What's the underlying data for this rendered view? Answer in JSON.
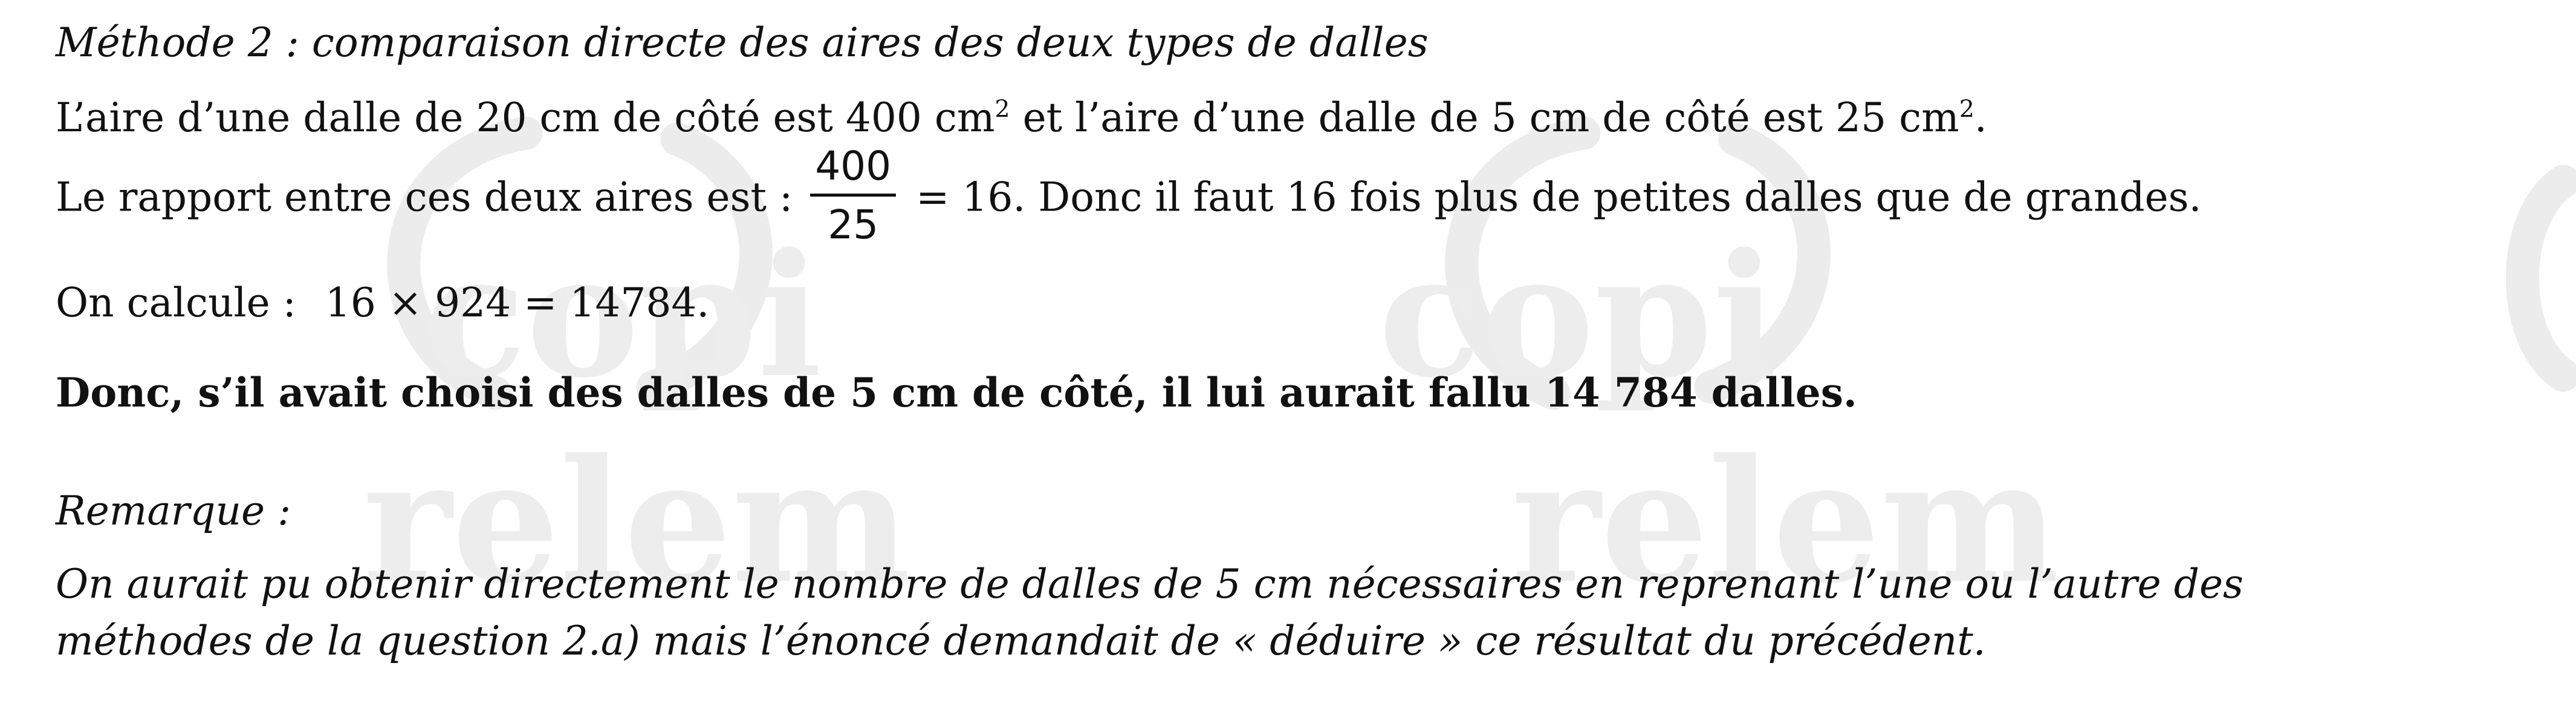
{
  "method_heading": "Méthode 2 : comparaison directe des aires des deux types de dalles",
  "area_line": {
    "part1": "L’aire d’une dalle de 20 cm de côté est 400 cm",
    "sup1": "2",
    "part2": " et l’aire d’une dalle de 5 cm de côté est 25 cm",
    "sup2": "2",
    "part3": "."
  },
  "ratio_line": {
    "intro": "Le rapport entre ces deux aires est :",
    "numerator": "400",
    "denominator": "25",
    "rest": "= 16. Donc il faut 16 fois plus de petites dalles que de grandes."
  },
  "calc_line": {
    "label": "On calcule :",
    "expression": "16 × 924 = 14784."
  },
  "conclusion": "Donc, s’il avait choisi des dalles de 5 cm de côté, il lui aurait fallu 14 784 dalles.",
  "remark_heading": "Remarque :",
  "remark_lines": [
    "On aurait pu obtenir directement le nombre de dalles de 5 cm nécessaires en reprenant l’une ou l’autre des",
    "méthodes de la question 2.a) mais l’énoncé demandait de « déduire » ce résultat du précédent."
  ],
  "watermark_text": {
    "top": "copi",
    "bottom": "relem"
  }
}
